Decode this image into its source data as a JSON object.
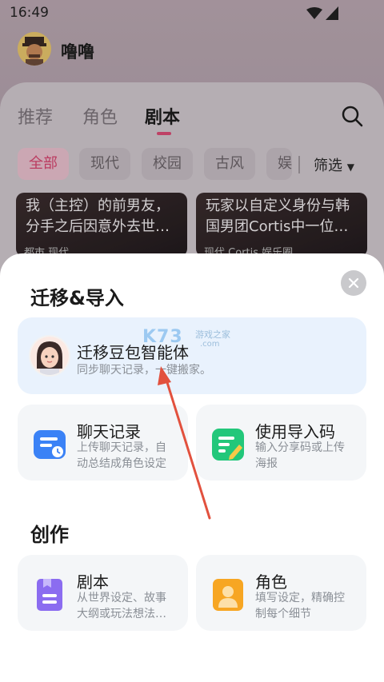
{
  "status": {
    "time": "16:49"
  },
  "profile": {
    "name": "噜噜"
  },
  "tabs": [
    {
      "label": "推荐"
    },
    {
      "label": "角色"
    },
    {
      "label": "剧本"
    }
  ],
  "chips": [
    {
      "label": "全部"
    },
    {
      "label": "现代"
    },
    {
      "label": "校园"
    },
    {
      "label": "古风"
    },
    {
      "label": "娱"
    }
  ],
  "filter": {
    "label": "筛选"
  },
  "stories": [
    {
      "text": "我（主控）的前男友，分手之后因意外去世…",
      "tags": "都市  现代"
    },
    {
      "text": "玩家以自定义身份与韩国男团Cortis中一位…",
      "tags": "现代  Cortis  娱乐圈"
    }
  ],
  "sheet": {
    "section_migrate": "迁移&导入",
    "migrate_card": {
      "title": "迁移豆包智能体",
      "subtitle": "同步聊天记录，一键搬家。"
    },
    "chat_card": {
      "title": "聊天记录",
      "subtitle_line1": "上传聊天记录，自",
      "subtitle_line2": "动总结成角色设定"
    },
    "code_card": {
      "title": "使用导入码",
      "subtitle_line1": "输入分享码或上传",
      "subtitle_line2": "海报"
    },
    "section_create": "创作",
    "script_card": {
      "title": "剧本",
      "subtitle_line1": "从世界设定、故事",
      "subtitle_line2": "大纲或玩法想法…"
    },
    "role_card": {
      "title": "角色",
      "subtitle_line1": "填写设定，精确控",
      "subtitle_line2": "制每个细节"
    }
  },
  "watermark": {
    "brand": "K73",
    "text": "游戏之家",
    "domain": ".com"
  },
  "colors": {
    "accent_pink": "#d94a74",
    "arrow_red": "#e2513e",
    "chat_blue": "#3b82f6",
    "code_green": "#22c77a",
    "script_purple": "#8b6cf0",
    "role_orange": "#f7a623"
  }
}
